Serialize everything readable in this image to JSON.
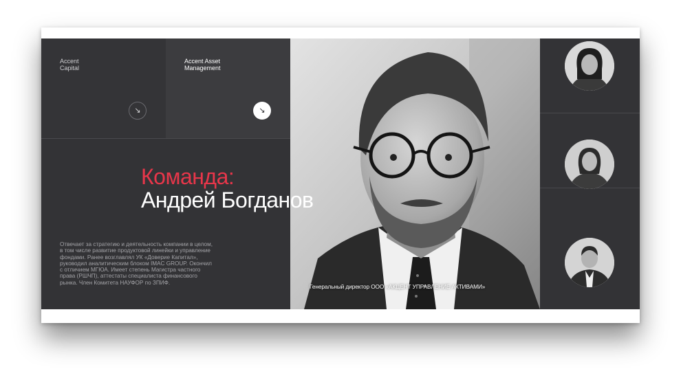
{
  "tabs": [
    {
      "name": "Accent\nCapital",
      "arrow": "↘",
      "active": false
    },
    {
      "name": "Accent Asset\nManagement",
      "arrow": "↘",
      "active": true
    }
  ],
  "heading": {
    "accent": "Команда:",
    "name": "Андрей Богданов"
  },
  "bio": "Отвечает за стратегию и деятельность компании в целом, в том числе развитие продуктовой линейки и управление фондами. Ранее возглавлял УК «Доверие Капитал», руководил аналитическим блоком IMAC GROUP. Окончил с отличием МГЮА. Имеет степень Магистра частного права (РШЧП), аттестаты специалиста финансового рынка. Член Комитета НАУФОР по ЗПИФ.",
  "portrait": {
    "caption": "Генеральный директор ООО «АКЦЕНТ УПРАВЛЕНИЕ АКТИВАМИ»"
  },
  "team": [
    {
      "id": "member-1",
      "icon": "woman-portrait"
    },
    {
      "id": "member-2",
      "icon": "woman-portrait"
    },
    {
      "id": "member-3",
      "icon": "man-portrait"
    }
  ],
  "colors": {
    "accent": "#e8364a",
    "slide_bg": "#333336",
    "active_tab_bg": "#3c3c3f"
  }
}
